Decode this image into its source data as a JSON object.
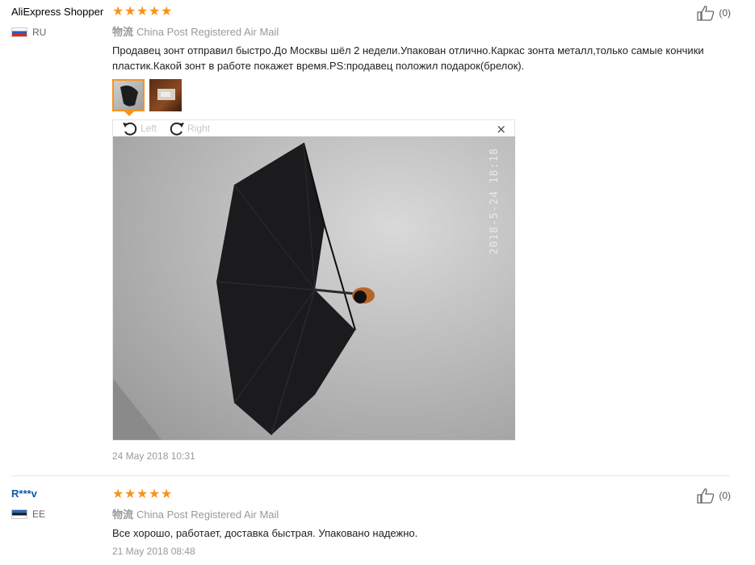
{
  "reviews": [
    {
      "author": "AliExpress Shopper",
      "country": "RU",
      "rating": 5,
      "shipping_cn": "物流",
      "shipping": "China Post Registered Air Mail",
      "text": "Продавец зонт отправил быстро.До Москвы шёл 2 недели.Упакован отлично.Каркас зонта металл,только самые кончики пластик.Какой зонт в работе покажет время.PS:продавец положил подарок(брелок).",
      "likes": "(0)",
      "date": "24 May 2018 10:31",
      "photo_stamp": "2018-5-24 18:18",
      "viewer": {
        "left_label": "Left",
        "right_label": "Right",
        "close": "×"
      }
    },
    {
      "author": "R***v",
      "country": "EE",
      "rating": 5,
      "shipping_cn": "物流",
      "shipping": "China Post Registered Air Mail",
      "text": "Все хорошо, работает, доставка быстрая. Упаковано надежно.",
      "likes": "(0)",
      "date": "21 May 2018 08:48"
    }
  ],
  "colors": {
    "star": "#f7931e",
    "author_link": "#0f5aa9"
  },
  "icons": {
    "star": "★",
    "like": "thumbs-up-icon",
    "rotate_left": "rotate-left-icon",
    "rotate_right": "rotate-right-icon"
  }
}
